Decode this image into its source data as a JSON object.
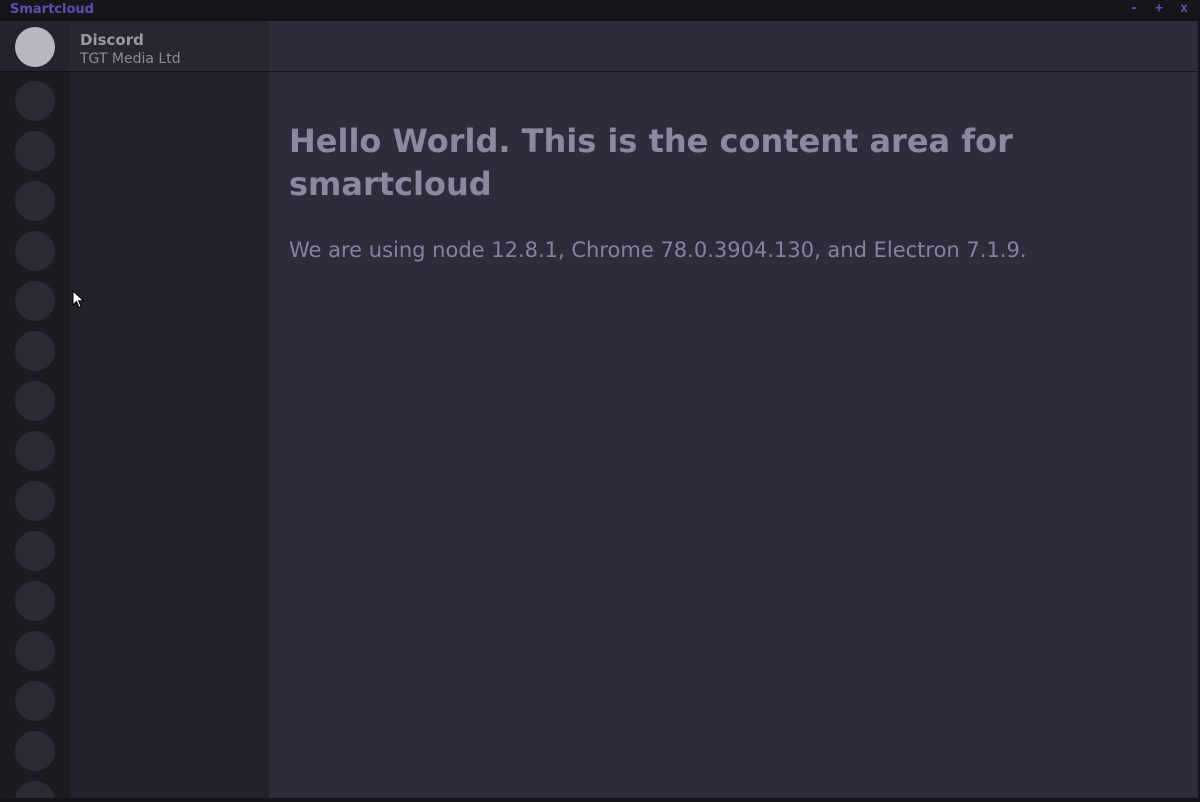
{
  "window": {
    "title": "Smartcloud",
    "controls": {
      "minimize": "-",
      "maximize": "+",
      "close": "x"
    },
    "accent_color": "#5b4fb0"
  },
  "server_header": {
    "name": "Discord",
    "organization": "TGT Media Ltd"
  },
  "server_rail": {
    "home_icon": "avatar-circle",
    "server_count": 15
  },
  "main": {
    "headline": "Hello World. This is the content area for smartcloud",
    "versions_text": "We are using node 12.8.1, Chrome 78.0.3904.130, and Electron 7.1.9."
  },
  "colors": {
    "background": "#2e2c3c",
    "sidebar": "#212129",
    "rail": "#1b1b21",
    "text": "#8b899c"
  }
}
